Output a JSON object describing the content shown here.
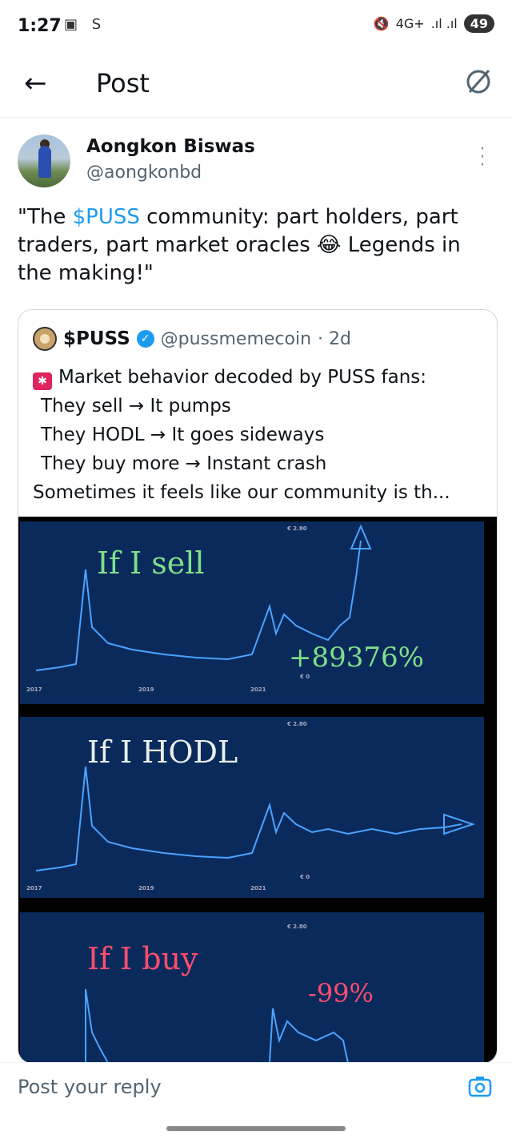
{
  "status_bar": {
    "time": "1:27",
    "left_icons": "▣ S",
    "network": "4G+",
    "signal": ".ıl .ıl",
    "battery": "49"
  },
  "header": {
    "back_icon": "arrow-left-icon",
    "title": "Post"
  },
  "post": {
    "author_name": "Aongkon Biswas",
    "author_handle": "@aongkonbd",
    "text_before": "\"The ",
    "cashtag": "$PUSS",
    "text_after": " community: part holders, part traders, part market oracles 😂 Legends in the making!\""
  },
  "quote": {
    "name": "$PUSS",
    "handle": "@pussmemecoin",
    "time": "· 2d",
    "lines": [
      "Market behavior decoded by PUSS fans:",
      "They sell → It pumps",
      "They HODL → It goes sideways",
      "They buy more → Instant crash",
      "Sometimes it feels like our community is th..."
    ]
  },
  "media": {
    "panels": [
      {
        "caption": "If I sell",
        "annotation": "+89376%",
        "price_top": "€ 2.80",
        "price_bottom": "€ 0",
        "ticks": [
          "2017",
          "2019",
          "2021"
        ],
        "color": "#7fe08a"
      },
      {
        "caption": "If I HODL",
        "annotation": "",
        "price_top": "€ 2.80",
        "price_bottom": "€ 0",
        "ticks": [
          "2017",
          "2019",
          "2021"
        ],
        "color": "#e9efe9"
      },
      {
        "caption": "If I buy",
        "annotation": "-99%",
        "price_top": "€ 2.80",
        "price_bottom": "",
        "ticks": [],
        "color": "#ff4d6d"
      }
    ]
  },
  "reply": {
    "placeholder": "Post your reply"
  }
}
